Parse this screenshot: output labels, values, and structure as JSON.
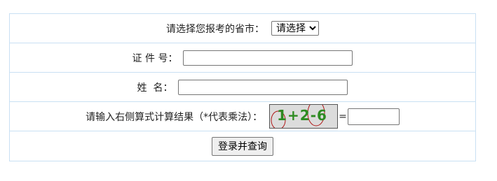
{
  "province": {
    "label": "请选择您报考的省市：",
    "selected": "请选择"
  },
  "id_number": {
    "label": "证 件 号：",
    "value": ""
  },
  "name": {
    "label": "姓  名：",
    "value": ""
  },
  "captcha": {
    "label": "请输入右侧算式计算结果（*代表乘法）：",
    "image_text": "1+2-6",
    "equals": "=",
    "answer": ""
  },
  "submit": {
    "label": "登录并查询"
  }
}
